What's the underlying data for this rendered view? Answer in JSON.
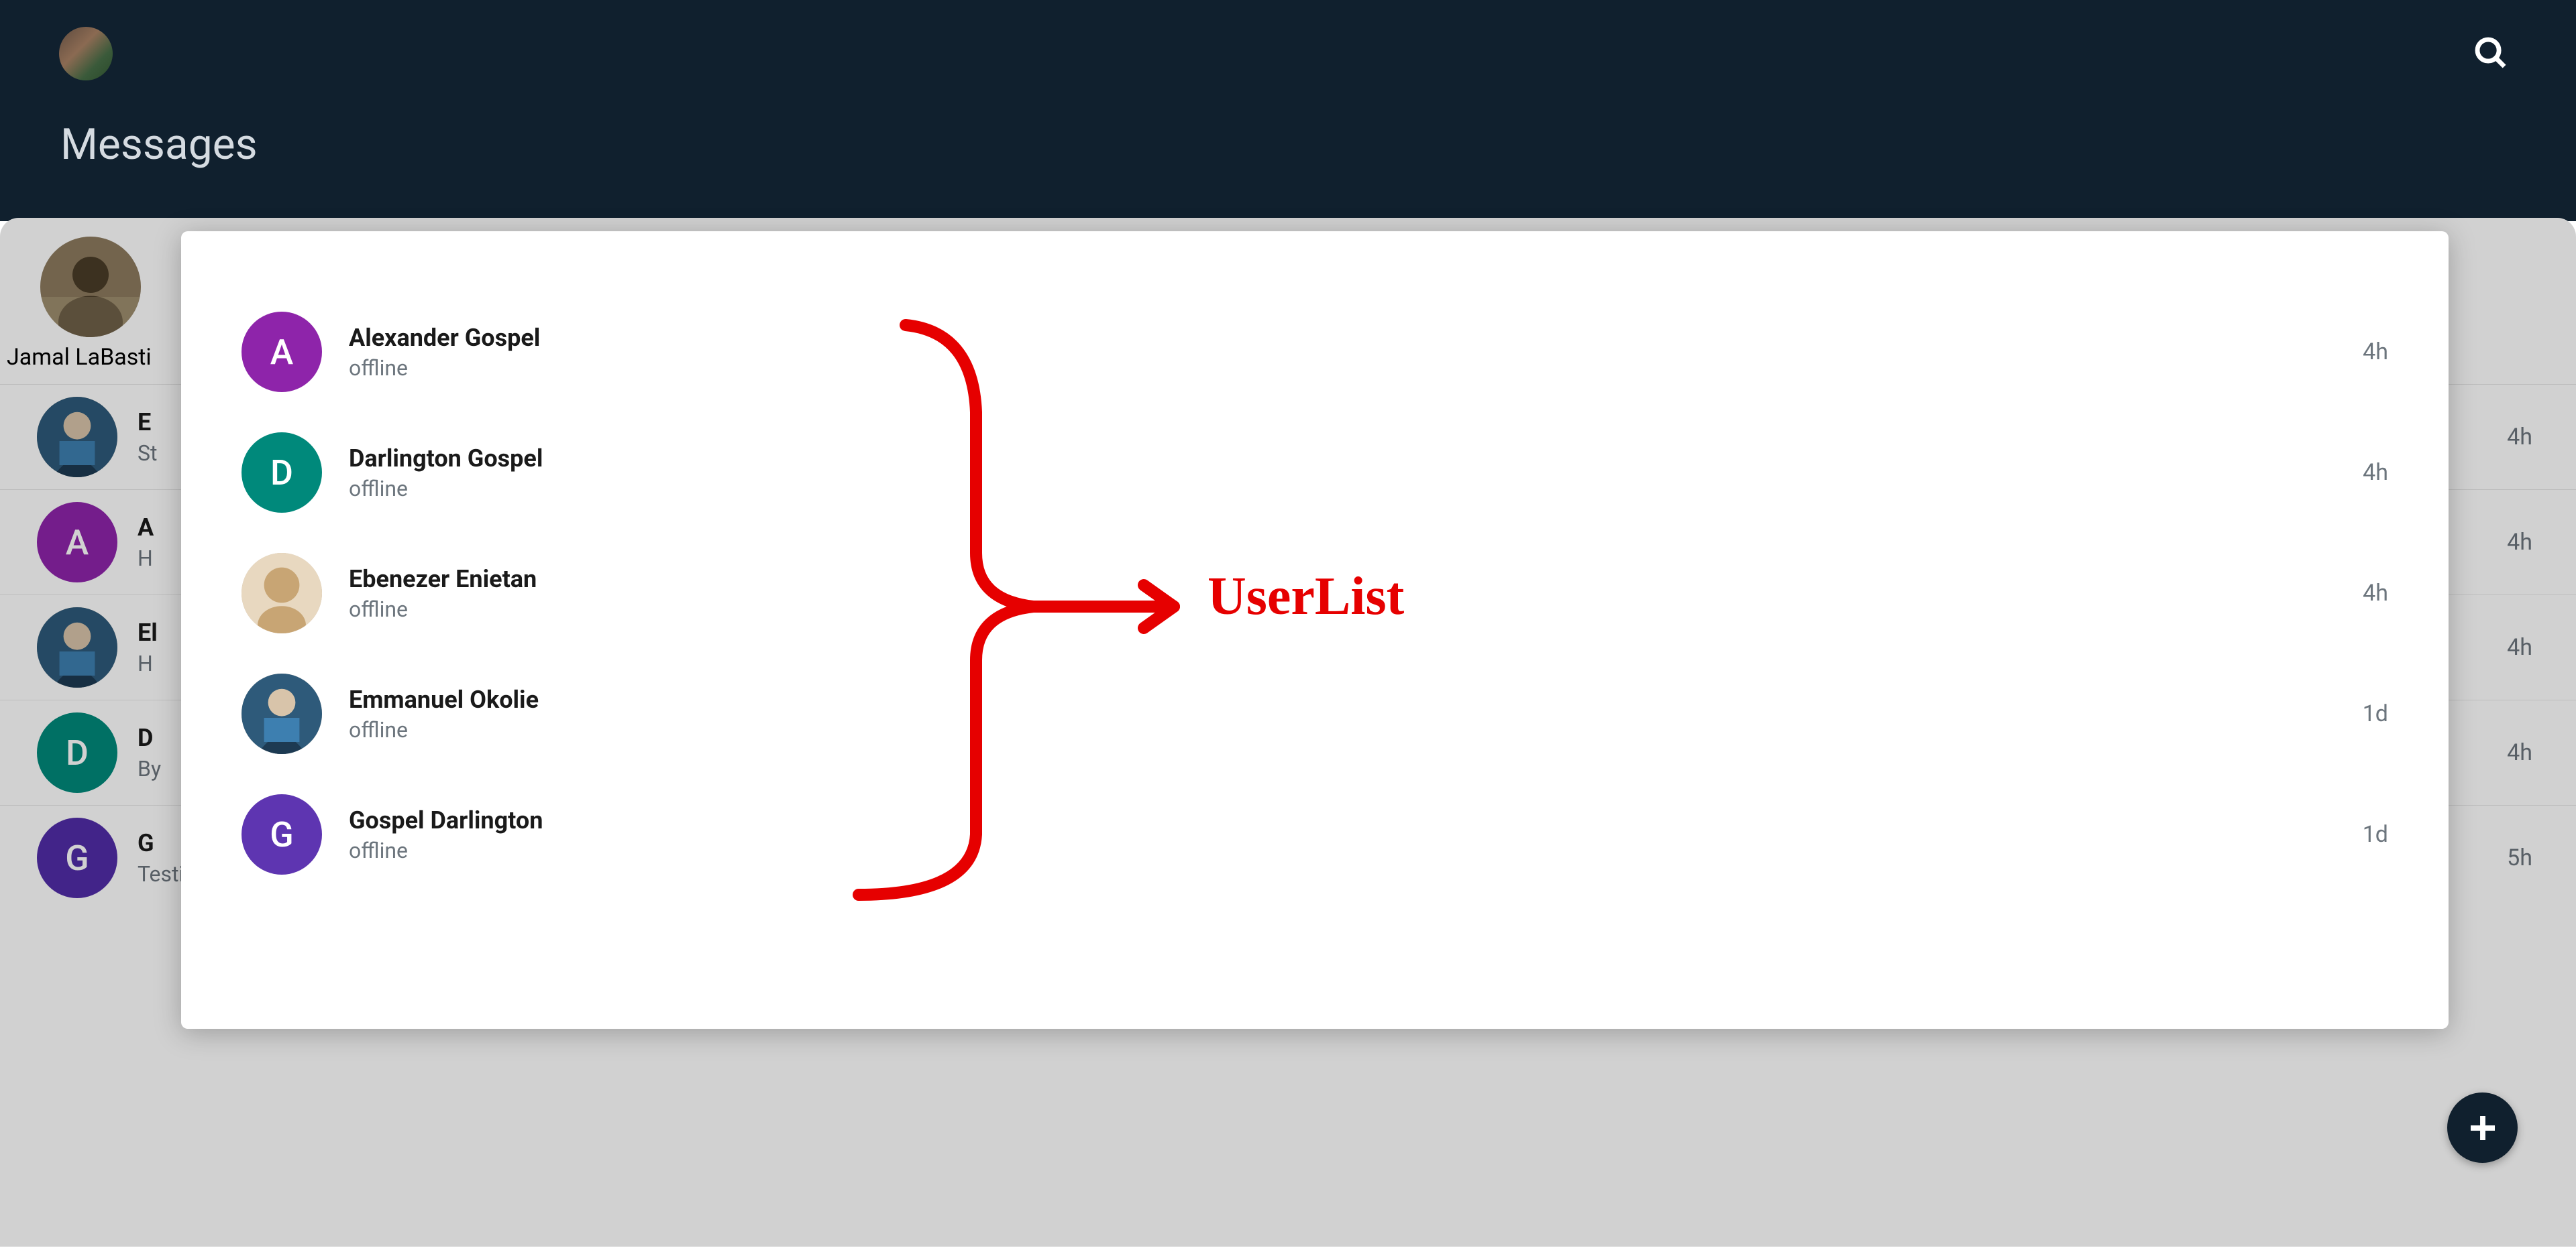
{
  "header": {
    "brand_initials": "",
    "title": "Messages"
  },
  "annotation": {
    "label": "UserList"
  },
  "featured": {
    "name": "Jamal LaBasti"
  },
  "conversations": [
    {
      "avatar_type": "photo",
      "initial": "",
      "bg": "ph-photo",
      "name": "E",
      "preview": "St",
      "time": "4h"
    },
    {
      "avatar_type": "initial",
      "initial": "A",
      "bg": "bg-purple",
      "name": "A",
      "preview": "H",
      "time": "4h"
    },
    {
      "avatar_type": "photo",
      "initial": "",
      "bg": "ph-photo",
      "name": "El",
      "preview": "H",
      "time": "4h"
    },
    {
      "avatar_type": "initial",
      "initial": "D",
      "bg": "bg-teal",
      "name": "D",
      "preview": "By",
      "time": "4h"
    },
    {
      "avatar_type": "initial",
      "initial": "G",
      "bg": "bg-deeppurp",
      "name": "G",
      "preview": "Testing again ...",
      "time": "5h"
    }
  ],
  "user_list": [
    {
      "avatar_type": "initial",
      "initial": "A",
      "bg": "bg-purple",
      "name": "Alexander Gospel",
      "status": "offline",
      "time": "4h"
    },
    {
      "avatar_type": "initial",
      "initial": "D",
      "bg": "bg-teal",
      "name": "Darlington Gospel",
      "status": "offline",
      "time": "4h"
    },
    {
      "avatar_type": "photo",
      "initial": "",
      "bg": "ph-photo",
      "name": "Ebenezer Enietan",
      "status": "offline",
      "time": "4h"
    },
    {
      "avatar_type": "photo",
      "initial": "",
      "bg": "ph-photo",
      "name": "Emmanuel Okolie",
      "status": "offline",
      "time": "1d"
    },
    {
      "avatar_type": "initial",
      "initial": "G",
      "bg": "bg-indigo",
      "name": "Gospel Darlington",
      "status": "offline",
      "time": "1d"
    }
  ]
}
